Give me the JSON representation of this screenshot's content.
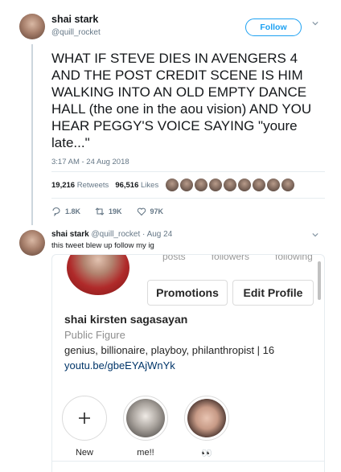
{
  "tweet1": {
    "name": "shai stark",
    "handle": "@quill_rocket",
    "follow_label": "Follow",
    "text": "WHAT IF STEVE DIES IN AVENGERS 4 AND THE POST CREDIT SCENE IS HIM WALKING INTO AN OLD EMPTY DANCE HALL (the one in the aou vision) AND YOU HEAR PEGGY'S VOICE SAYING \"youre late...\"",
    "timestamp": "3:17 AM - 24 Aug 2018",
    "retweets_count": "19,216",
    "retweets_label": "Retweets",
    "likes_count": "96,516",
    "likes_label": "Likes",
    "reply_count": "1.8K",
    "retweet_count_short": "19K",
    "like_count_short": "97K"
  },
  "tweet2": {
    "name": "shai stark",
    "handle": "@quill_rocket",
    "date": "Aug 24",
    "text": "this tweet blew up follow my ig"
  },
  "instagram": {
    "stat_labels": [
      "posts",
      "followers",
      "following"
    ],
    "promotions_label": "Promotions",
    "edit_profile_label": "Edit Profile",
    "name": "shai kirsten sagasayan",
    "category": "Public Figure",
    "bio": "genius, billionaire, playboy, philanthropist | 16",
    "link": "youtu.be/gbeEYAjWnYk",
    "highlights": [
      {
        "label": "New",
        "icon": "plus-icon"
      },
      {
        "label": "me!!"
      },
      {
        "label": "👀"
      }
    ]
  },
  "colors": {
    "twitter_blue": "#1da1f2",
    "secondary_text": "#657786",
    "ig_link": "#003569"
  }
}
